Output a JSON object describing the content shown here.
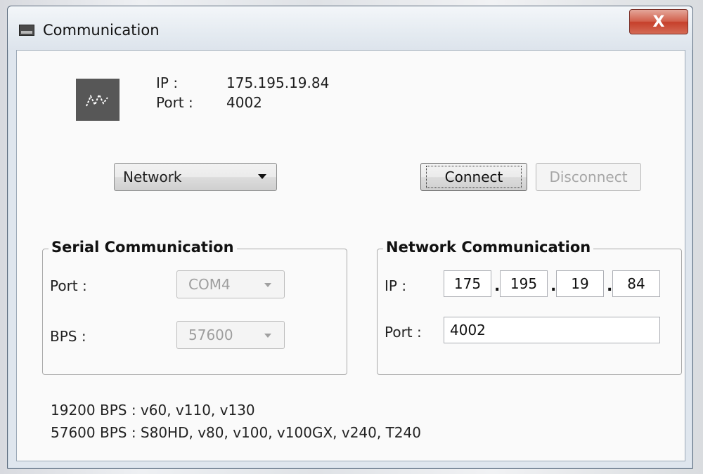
{
  "window": {
    "title": "Communication",
    "close_label": "X"
  },
  "info": {
    "ip_label": "IP :",
    "ip_value": "175.195.19.84",
    "port_label": "Port :",
    "port_value": "4002"
  },
  "mode_select": {
    "value": "Network"
  },
  "buttons": {
    "connect": "Connect",
    "disconnect": "Disconnect"
  },
  "serial": {
    "title": "Serial Communication",
    "port_label": "Port :",
    "port_value": "COM4",
    "bps_label": "BPS :",
    "bps_value": "57600"
  },
  "network": {
    "title": "Network Communication",
    "ip_label": "IP :",
    "ip_parts": [
      "175",
      "195",
      "19",
      "84"
    ],
    "port_label": "Port :",
    "port_value": "4002"
  },
  "notes": {
    "line1": "19200 BPS : v60, v110, v130",
    "line2": "57600 BPS : S80HD, v80, v100, v100GX, v240, T240"
  }
}
